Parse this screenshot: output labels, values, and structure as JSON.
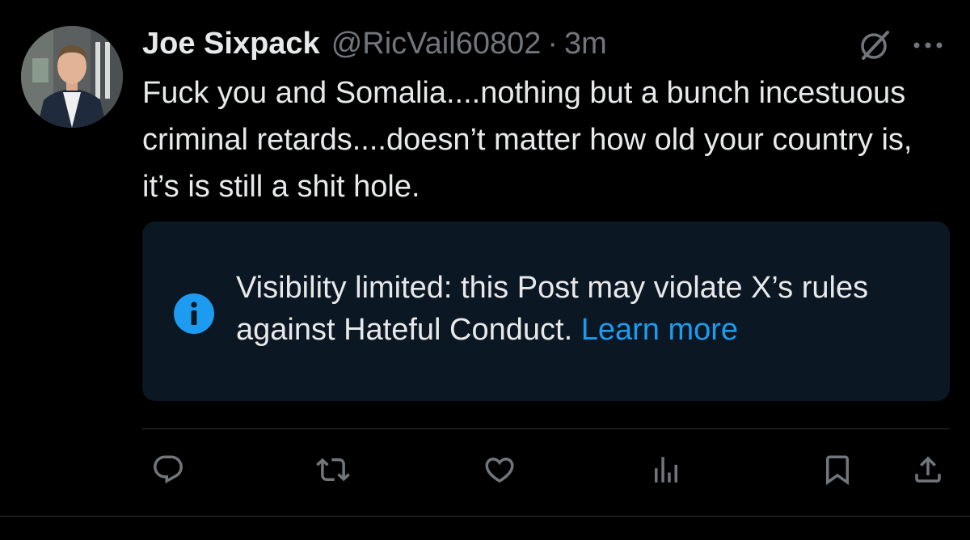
{
  "post": {
    "author": {
      "display_name": "Joe Sixpack",
      "handle": "@RicVail60802",
      "avatar_icon": "profile-photo"
    },
    "separator": "·",
    "time": "3m",
    "text": "Fuck you and Somalia....nothing but a bunch incestuous criminal retards....doesn’t matter how old your country is, it’s is still a shit hole.",
    "header_icons": [
      "grok-icon",
      "more-icon"
    ]
  },
  "notice": {
    "icon": "info-icon",
    "text": "Visibility limited: this Post may violate X’s rules against Hateful Conduct.",
    "link_text": "Learn more"
  },
  "actions": [
    {
      "name": "reply",
      "icon": "reply-icon"
    },
    {
      "name": "repost",
      "icon": "repost-icon"
    },
    {
      "name": "like",
      "icon": "like-icon"
    },
    {
      "name": "views",
      "icon": "views-icon"
    },
    {
      "name": "bookmark",
      "icon": "bookmark-icon"
    },
    {
      "name": "share",
      "icon": "share-icon"
    }
  ],
  "colors": {
    "background": "#000000",
    "text": "#e7e9ea",
    "secondary_text": "#71767b",
    "notice_background": "#0b1722",
    "accent": "#1d9bf0",
    "divider": "#2f3336"
  }
}
